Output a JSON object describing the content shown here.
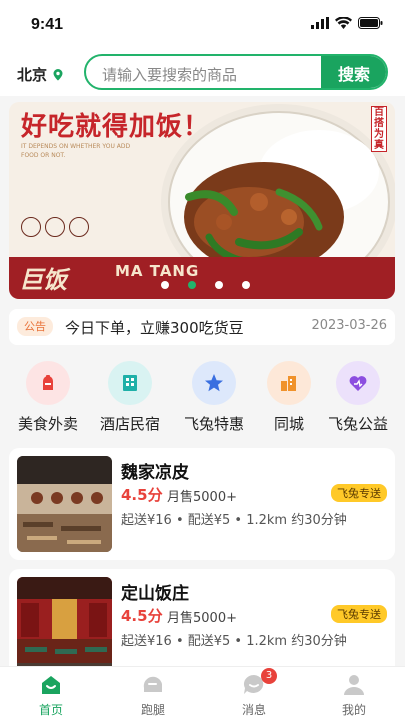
{
  "status_bar": {
    "time": "9:41"
  },
  "header": {
    "city": "北京",
    "search": {
      "placeholder": "请输入要搜索的商品",
      "button_label": "搜索"
    }
  },
  "banner": {
    "title": "好吃就得加饭！",
    "subtitle": "IT DEPENDS ON WHETHER YOU ADD FOOD OR NOT.",
    "strip_left": "巨饭",
    "strip_mid": "MA TANG",
    "badge": "百搭为真",
    "active_dot_index": 1
  },
  "notice": {
    "tag": "公告",
    "text": "今日下单，立赚300吃货豆",
    "date": "2023-03-26"
  },
  "categories": [
    {
      "label": "美食外卖",
      "icon": "food-delivery-icon",
      "bg": "#fde4e4",
      "color": "#e8423b"
    },
    {
      "label": "酒店民宿",
      "icon": "hotel-icon",
      "bg": "#d9f3f2",
      "color": "#1fb0a8"
    },
    {
      "label": "飞兔特惠",
      "icon": "star-deal-icon",
      "bg": "#dde8fb",
      "color": "#3a6fe0"
    },
    {
      "label": "同城",
      "icon": "city-building-icon",
      "bg": "#fde8d8",
      "color": "#f0922b"
    },
    {
      "label": "飞兔公益",
      "icon": "charity-heart-icon",
      "bg": "#ece1fb",
      "color": "#8c4ee0"
    }
  ],
  "shops": [
    {
      "name": "魏家凉皮",
      "rating": "4.5分",
      "sales": "月售5000+",
      "info": "起送¥16 • 配送¥5 • 1.2km 约30分钟",
      "tag": "飞兔专送"
    },
    {
      "name": "定山饭庄",
      "rating": "4.5分",
      "sales": "月售5000+",
      "info": "起送¥16 • 配送¥5 • 1.2km 约30分钟",
      "tag": "飞兔专送"
    }
  ],
  "tabbar": {
    "tabs": [
      {
        "label": "首页",
        "icon": "home-icon",
        "active": true
      },
      {
        "label": "跑腿",
        "icon": "errand-icon",
        "active": false
      },
      {
        "label": "消息",
        "icon": "message-icon",
        "active": false,
        "badge": "3"
      },
      {
        "label": "我的",
        "icon": "profile-icon",
        "active": false
      }
    ]
  },
  "colors": {
    "brand": "#1aa45f",
    "accent_red": "#e8423b",
    "tag_yellow": "#ffc928"
  }
}
